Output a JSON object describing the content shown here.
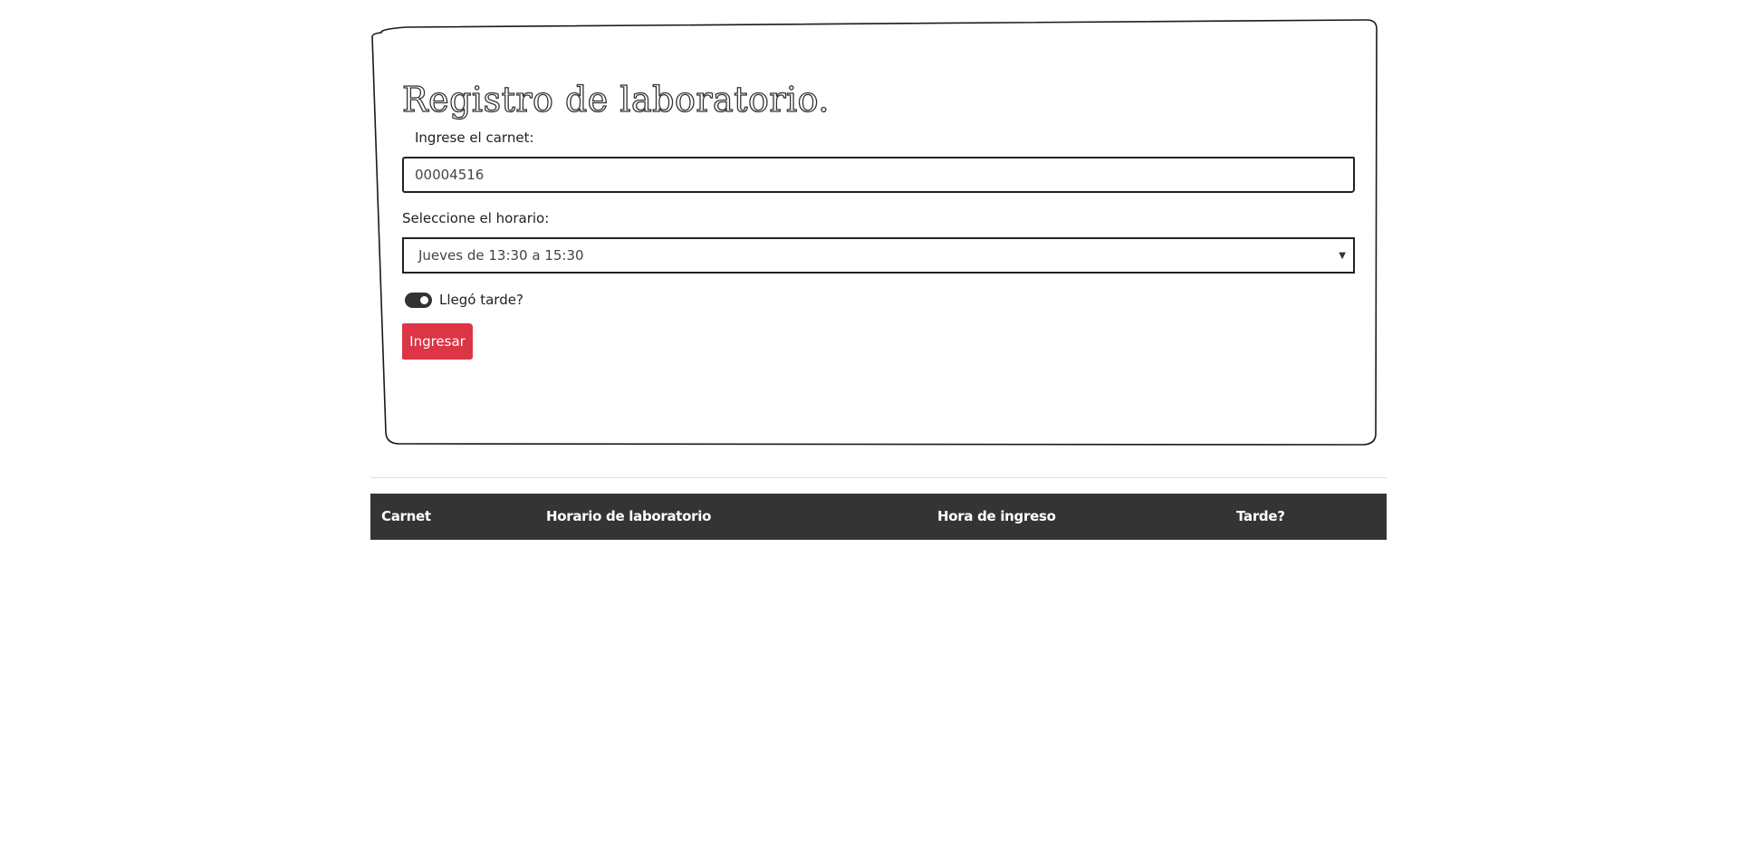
{
  "form": {
    "title": "Registro de laboratorio.",
    "carnet_label": "Ingrese el carnet:",
    "carnet_value": "00004516",
    "horario_label": "Seleccione el horario:",
    "horario_selected": "Jueves de 13:30 a 15:30",
    "late_toggle_label": "Llegó tarde?",
    "late_toggle_on": true,
    "submit_label": "Ingresar",
    "submit_color": "#dc3545"
  },
  "table": {
    "headers": [
      "Carnet",
      "Horario de laboratorio",
      "Hora de ingreso",
      "Tarde?"
    ],
    "header_bg": "#343434",
    "rows": []
  }
}
